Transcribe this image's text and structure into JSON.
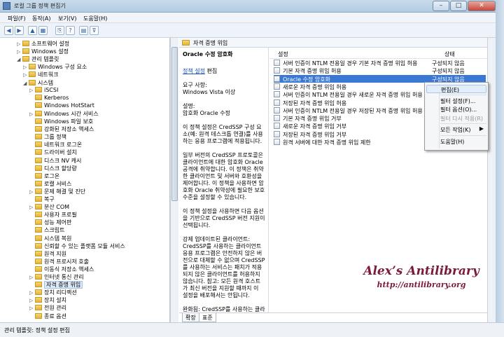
{
  "window": {
    "title": "로컬 그룹 정책 편집기",
    "buttons": {
      "minimize": "–",
      "maximize": "□",
      "close": "✕"
    }
  },
  "menu": [
    "파일(F)",
    "동작(A)",
    "보기(V)",
    "도움말(H)"
  ],
  "toolbar": {
    "icons": [
      "back-icon",
      "forward-icon",
      "up-folder-icon",
      "show-hide-tree-icon",
      "export-list-icon",
      "help-icon",
      "properties-icon",
      "filter-icon"
    ],
    "glyphs": [
      "◀",
      "▶",
      "▲",
      "▦",
      "⎘",
      "?",
      "▤",
      "⊽"
    ]
  },
  "tree": [
    {
      "label": "소프트웨어 설정",
      "indent": 2,
      "expander": "▷"
    },
    {
      "label": "Windows 설정",
      "indent": 2,
      "expander": "▷"
    },
    {
      "label": "관리 템플릿",
      "indent": 2,
      "expander": "◢"
    },
    {
      "label": "Windows 구성 요소",
      "indent": 3,
      "expander": "▷"
    },
    {
      "label": "네트워크",
      "indent": 3,
      "expander": "▷"
    },
    {
      "label": "시스템",
      "indent": 3,
      "expander": "◢"
    },
    {
      "label": "iSCSI",
      "indent": 4,
      "expander": "▷"
    },
    {
      "label": "Kerberos",
      "indent": 4,
      "expander": ""
    },
    {
      "label": "Windows HotStart",
      "indent": 4,
      "expander": ""
    },
    {
      "label": "Windows 시간 서비스",
      "indent": 4,
      "expander": "▷"
    },
    {
      "label": "Windows 파일 보호",
      "indent": 4,
      "expander": ""
    },
    {
      "label": "강화된 저장소 액세스",
      "indent": 4,
      "expander": ""
    },
    {
      "label": "그룹 정책",
      "indent": 4,
      "expander": ""
    },
    {
      "label": "네트워크 로그온",
      "indent": 4,
      "expander": ""
    },
    {
      "label": "드라이버 설치",
      "indent": 4,
      "expander": ""
    },
    {
      "label": "디스크 NV 캐시",
      "indent": 4,
      "expander": ""
    },
    {
      "label": "디스크 할당량",
      "indent": 4,
      "expander": ""
    },
    {
      "label": "로그온",
      "indent": 4,
      "expander": ""
    },
    {
      "label": "로캘 서비스",
      "indent": 4,
      "expander": ""
    },
    {
      "label": "문제 해결 및 진단",
      "indent": 4,
      "expander": "▷"
    },
    {
      "label": "복구",
      "indent": 4,
      "expander": ""
    },
    {
      "label": "분산 COM",
      "indent": 4,
      "expander": "▷"
    },
    {
      "label": "사용자 프로필",
      "indent": 4,
      "expander": ""
    },
    {
      "label": "성능 제어판",
      "indent": 4,
      "expander": ""
    },
    {
      "label": "스크립트",
      "indent": 4,
      "expander": ""
    },
    {
      "label": "시스템 복원",
      "indent": 4,
      "expander": ""
    },
    {
      "label": "신뢰할 수 있는 플랫폼 모듈 서비스",
      "indent": 4,
      "expander": ""
    },
    {
      "label": "원격 지원",
      "indent": 4,
      "expander": ""
    },
    {
      "label": "원격 프로시저 호출",
      "indent": 4,
      "expander": ""
    },
    {
      "label": "이동식 저장소 액세스",
      "indent": 4,
      "expander": ""
    },
    {
      "label": "인터넷 통신 관리",
      "indent": 4,
      "expander": "▷"
    },
    {
      "label": "자격 증명 위임",
      "indent": 4,
      "expander": "",
      "selected": true
    },
    {
      "label": "장치 리디렉션",
      "indent": 4,
      "expander": "▷"
    },
    {
      "label": "장치 설치",
      "indent": 4,
      "expander": "▷"
    },
    {
      "label": "전원 관리",
      "indent": 4,
      "expander": "▷"
    },
    {
      "label": "종료 옵션",
      "indent": 4,
      "expander": ""
    }
  ],
  "right_pane": {
    "header": "자격 증명 위임",
    "description": {
      "title": "Oracle 수정 암호화",
      "edit_prefix": "정책 설정",
      "edit_suffix": " 편집",
      "paragraphs": [
        "요구 사항:\nWindows Vista 이상",
        "설명:\n암호화 Oracle 수정",
        "이 정책 설정은 CredSSP 구성 요소(예: 원격 데스크톱 연결)를 사용하는 응용 프로그램에 적용됩니다.",
        "일부 버전의 CredSSP 프로토콜은 클라이언트에 대한 암호화 Oracle 공격에 취약합니다. 이 정책은 취약한 클라이언트 및 서버와 호환성을 제어합니다. 이 정책을 사용하면 암호화 Oracle 취약성에 필요한 보호 수준을 설정할 수 있습니다.",
        "이 정책 설정을 사용하면 다음 옵션을 기반으로 CredSSP 버전 지원이 선택됩니다.",
        "강제 업데이트된 클라이언트: CredSSP를 사용하는 클라이언트 응용 프로그램은 안전하지 않은 버전으로 대체할 수 없으며 CredSSP를 사용하는 서비스는 패치가 적용되지 않은 클라이언트를 허용하지 않습니다. 참고: 모든 원격 호스트가 최신 버전을 지원할 때까지 이 설정을 배포해서는 안됩니다.",
        "완화됨: CredSSP를 사용하는 클라이언트 응용 프로그램은 안전하지"
      ]
    },
    "columns": {
      "setting": "설정",
      "state": "상태"
    },
    "rows": [
      {
        "name": "서버 인증이 NTLM 전용일 경우 기본 자격 증명 위임 허용",
        "state": "구성되지 않음"
      },
      {
        "name": "기본 자격 증명 위임 허용",
        "state": "구성되지 않음"
      },
      {
        "name": "Oracle 수정 암호화",
        "state": "구성되지 않음",
        "selected": true
      },
      {
        "name": "새로운 자격 증명 위임 허용",
        "state": ""
      },
      {
        "name": "서버 인증이 NTLM 전용일 경우 새로운 자격 증명 위임 허용",
        "state": ""
      },
      {
        "name": "저장된 자격 증명 위임 허용",
        "state": ""
      },
      {
        "name": "서버 인증이 NTLM 전용일 경우 저장된 자격 증명 위임 허용",
        "state": ""
      },
      {
        "name": "기본 자격 증명 위임 거부",
        "state": ""
      },
      {
        "name": "새로운 자격 증명 위임 거부",
        "state": ""
      },
      {
        "name": "저장된 자격 증명 위임 거부",
        "state": ""
      },
      {
        "name": "원격 서버에 대한 자격 증명 위임 제한",
        "state": ""
      }
    ],
    "tabs": [
      "확장",
      "표준"
    ]
  },
  "context_menu": [
    {
      "label": "편집(E)",
      "hover": true
    },
    {
      "sep": true
    },
    {
      "label": "필터 설정(F)..."
    },
    {
      "label": "필터 옵션(O)..."
    },
    {
      "label": "필터 다시 적용(R)",
      "disabled": true
    },
    {
      "sep": true
    },
    {
      "label": "모든 작업(K)",
      "arrow": "▶"
    },
    {
      "sep": true
    },
    {
      "label": "도움말(H)"
    }
  ],
  "status_text": "관리 템플릿: 정책 설정 편집",
  "watermark": {
    "line1": "Alex’s Antilibrary",
    "line2": "http://antilibrary.org"
  },
  "colors": {
    "selection": "#3a78d4",
    "link": "#1b52b3",
    "watermark": "#7a1b3c"
  }
}
